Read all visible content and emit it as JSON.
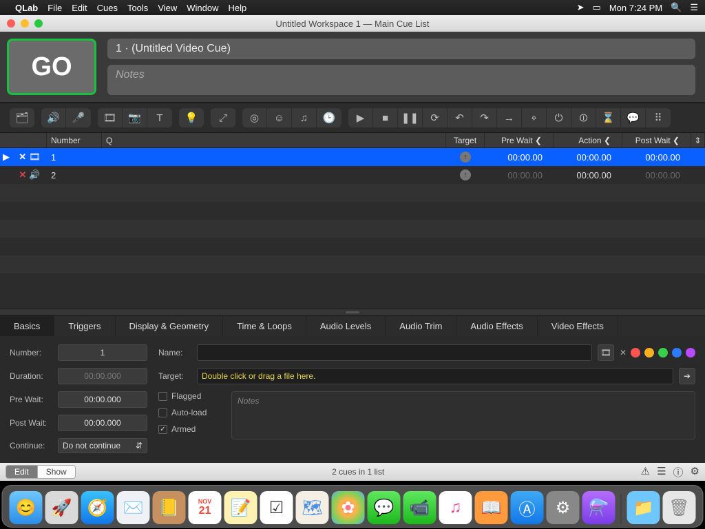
{
  "menubar": {
    "app": "QLab",
    "items": [
      "File",
      "Edit",
      "Cues",
      "Tools",
      "View",
      "Window",
      "Help"
    ],
    "clock": "Mon 7:24 PM"
  },
  "window": {
    "title": "Untitled Workspace 1 — Main Cue List"
  },
  "go_button": "GO",
  "current_cue": "1 · (Untitled Video Cue)",
  "notes_placeholder": "Notes",
  "columns": {
    "number": "Number",
    "q": "Q",
    "target": "Target",
    "prewait": "Pre Wait",
    "action": "Action",
    "postwait": "Post Wait"
  },
  "rows": [
    {
      "num": "1",
      "type": "video",
      "broken": true,
      "prewait": "00:00.00",
      "action": "00:00.00",
      "postwait": "00:00.00",
      "selected": true
    },
    {
      "num": "2",
      "type": "audio",
      "broken": true,
      "prewait": "00:00.00",
      "action": "00:00.00",
      "postwait": "00:00.00",
      "selected": false,
      "prewait_dim": true,
      "postwait_dim": true
    }
  ],
  "inspector": {
    "tabs": [
      "Basics",
      "Triggers",
      "Display & Geometry",
      "Time & Loops",
      "Audio Levels",
      "Audio Trim",
      "Audio Effects",
      "Video Effects"
    ],
    "active_tab": 0,
    "labels": {
      "number": "Number:",
      "duration": "Duration:",
      "prewait": "Pre Wait:",
      "postwait": "Post Wait:",
      "continue": "Continue:",
      "name": "Name:",
      "target": "Target:",
      "flagged": "Flagged",
      "autoload": "Auto-load",
      "armed": "Armed"
    },
    "values": {
      "number": "1",
      "duration": "00:00.000",
      "prewait": "00:00.000",
      "postwait": "00:00.000",
      "continue": "Do not continue",
      "name": "",
      "target_msg": "Double click or drag a file here.",
      "flagged": false,
      "autoload": false,
      "armed": true,
      "notes_placeholder": "Notes"
    },
    "colors": [
      "#ff5252",
      "#ffb020",
      "#38d14c",
      "#2f7bff",
      "#b84bff"
    ]
  },
  "bottom": {
    "mode_edit": "Edit",
    "mode_show": "Show",
    "status": "2 cues in 1 list"
  },
  "dock": [
    "finder",
    "launchpad",
    "safari",
    "mail",
    "contacts",
    "calendar",
    "notes",
    "reminders",
    "maps",
    "photos",
    "messages",
    "facetime",
    "itunes",
    "ibooks",
    "appstore",
    "preferences",
    "qlab",
    "|",
    "downloads",
    "trash"
  ]
}
